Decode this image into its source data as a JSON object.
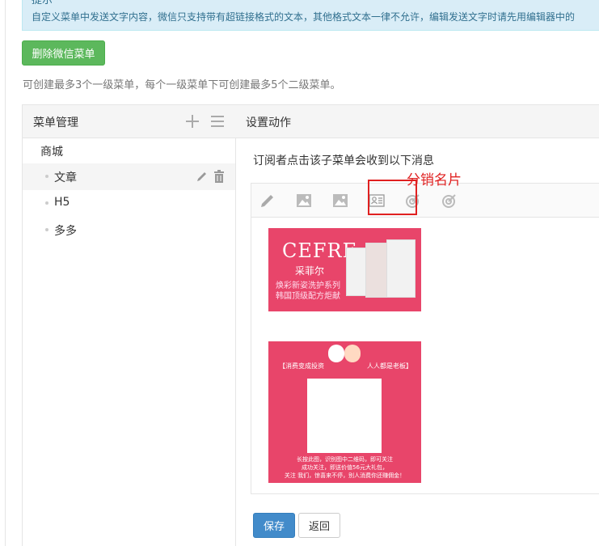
{
  "tip": {
    "title": "提示",
    "text": "自定义菜单中发送文字内容，微信只支持带有超链接格式的文本，其他格式文本一律不允许，编辑发送文字时请先用编辑器中的"
  },
  "delete_button": "删除微信菜单",
  "hint": "可创建最多3个一级菜单，每个一级菜单下可创建最多5个二级菜单。",
  "menu_panel": {
    "title": "菜单管理",
    "root_item": "商城",
    "sub_items": [
      {
        "label": "文章",
        "active": true
      },
      {
        "label": "H5",
        "active": false
      },
      {
        "label": "多多",
        "active": false
      }
    ]
  },
  "action_panel": {
    "title": "设置动作",
    "description": "订阅者点击该子菜单会收到以下消息",
    "annotation": "分销名片",
    "toolbar_icons": [
      "pencil-icon",
      "image-icon",
      "image-icon",
      "contact-card-icon",
      "target-icon",
      "target-icon"
    ]
  },
  "card1": {
    "brand": "CEFRE",
    "brand_cn": "采菲尔",
    "line1": "焕彩新姿洗护系列",
    "line2": "韩国顶级配方炬献"
  },
  "card2": {
    "top_left": "【消费变成投资",
    "top_right": "人人都是老板】",
    "bottom1": "长按此图，识别图中二维码，即可关注",
    "bottom2": "成功关注，即送价值56元大礼包，",
    "bottom3": "关注 我们，惊喜来不停，别人消费你还赚佣金！"
  },
  "buttons": {
    "save": "保存",
    "back": "返回"
  },
  "colors": {
    "accent_green": "#5cb85c",
    "primary_blue": "#428bca",
    "annotation_red": "#e02020",
    "card_pink": "#e8456a"
  }
}
